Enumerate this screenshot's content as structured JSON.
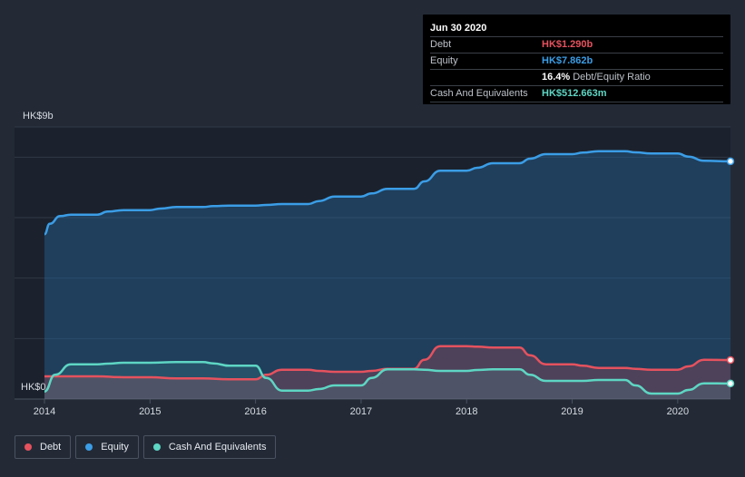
{
  "tooltip": {
    "date": "Jun 30 2020",
    "rows": [
      {
        "label": "Debt",
        "value": "HK$1.290b",
        "color": "#e5525e"
      },
      {
        "label": "Equity",
        "value": "HK$7.862b",
        "color": "#3b9de6"
      },
      {
        "label": "",
        "value": "16.4%",
        "extra": "Debt/Equity Ratio",
        "color": "#ffffff"
      },
      {
        "label": "Cash And Equivalents",
        "value": "HK$512.663m",
        "color": "#5ed6c4"
      }
    ]
  },
  "legend": [
    {
      "label": "Debt",
      "color": "#e5525e"
    },
    {
      "label": "Equity",
      "color": "#3b9de6"
    },
    {
      "label": "Cash And Equivalents",
      "color": "#5ed6c4"
    }
  ],
  "chart_data": {
    "type": "area",
    "ylabel_top": "HK$9b",
    "ylabel_bottom": "HK$0",
    "ylim": [
      0,
      9
    ],
    "xlim": [
      2014,
      2020.5
    ],
    "x_ticks": [
      "2014",
      "2015",
      "2016",
      "2017",
      "2018",
      "2019",
      "2020"
    ],
    "grid": true,
    "series": [
      {
        "name": "Equity",
        "color": "#3b9de6",
        "x": [
          2014.0,
          2014.05,
          2014.15,
          2014.25,
          2014.5,
          2014.6,
          2014.75,
          2015.0,
          2015.1,
          2015.25,
          2015.5,
          2015.6,
          2015.75,
          2016.0,
          2016.1,
          2016.25,
          2016.5,
          2016.6,
          2016.75,
          2017.0,
          2017.1,
          2017.25,
          2017.5,
          2017.6,
          2017.75,
          2018.0,
          2018.1,
          2018.25,
          2018.5,
          2018.6,
          2018.75,
          2019.0,
          2019.1,
          2019.25,
          2019.5,
          2019.6,
          2019.75,
          2020.0,
          2020.1,
          2020.25,
          2020.5
        ],
        "values": [
          5.45,
          5.8,
          6.05,
          6.1,
          6.1,
          6.2,
          6.25,
          6.25,
          6.3,
          6.35,
          6.35,
          6.38,
          6.4,
          6.4,
          6.42,
          6.45,
          6.45,
          6.55,
          6.7,
          6.7,
          6.8,
          6.95,
          6.95,
          7.2,
          7.55,
          7.55,
          7.65,
          7.8,
          7.8,
          7.95,
          8.1,
          8.1,
          8.15,
          8.2,
          8.2,
          8.16,
          8.12,
          8.12,
          8.02,
          7.88,
          7.862
        ]
      },
      {
        "name": "Debt",
        "color": "#e5525e",
        "x": [
          2014.0,
          2014.25,
          2014.5,
          2014.75,
          2015.0,
          2015.25,
          2015.5,
          2015.75,
          2016.0,
          2016.1,
          2016.25,
          2016.5,
          2016.6,
          2016.75,
          2017.0,
          2017.1,
          2017.25,
          2017.5,
          2017.6,
          2017.75,
          2018.0,
          2018.1,
          2018.25,
          2018.5,
          2018.6,
          2018.75,
          2019.0,
          2019.1,
          2019.25,
          2019.5,
          2019.6,
          2019.75,
          2020.0,
          2020.1,
          2020.25,
          2020.5
        ],
        "values": [
          0.75,
          0.75,
          0.75,
          0.72,
          0.72,
          0.68,
          0.68,
          0.65,
          0.65,
          0.8,
          0.97,
          0.97,
          0.93,
          0.9,
          0.9,
          0.93,
          1.0,
          1.0,
          1.3,
          1.75,
          1.75,
          1.73,
          1.7,
          1.7,
          1.45,
          1.15,
          1.15,
          1.1,
          1.03,
          1.03,
          1.0,
          0.97,
          0.97,
          1.08,
          1.3,
          1.29
        ]
      },
      {
        "name": "Cash And Equivalents",
        "color": "#5ed6c4",
        "x": [
          2014.0,
          2014.1,
          2014.25,
          2014.5,
          2014.6,
          2014.75,
          2015.0,
          2015.25,
          2015.5,
          2015.6,
          2015.75,
          2016.0,
          2016.1,
          2016.25,
          2016.5,
          2016.6,
          2016.75,
          2017.0,
          2017.1,
          2017.25,
          2017.5,
          2017.6,
          2017.75,
          2018.0,
          2018.1,
          2018.25,
          2018.5,
          2018.6,
          2018.75,
          2019.0,
          2019.1,
          2019.25,
          2019.5,
          2019.6,
          2019.75,
          2020.0,
          2020.1,
          2020.25,
          2020.5
        ],
        "values": [
          0.25,
          0.8,
          1.15,
          1.15,
          1.17,
          1.2,
          1.2,
          1.22,
          1.22,
          1.18,
          1.1,
          1.1,
          0.7,
          0.28,
          0.28,
          0.33,
          0.45,
          0.45,
          0.7,
          0.98,
          0.98,
          0.97,
          0.93,
          0.93,
          0.96,
          0.98,
          0.98,
          0.8,
          0.6,
          0.6,
          0.6,
          0.63,
          0.63,
          0.45,
          0.18,
          0.18,
          0.3,
          0.52,
          0.513
        ]
      }
    ]
  }
}
